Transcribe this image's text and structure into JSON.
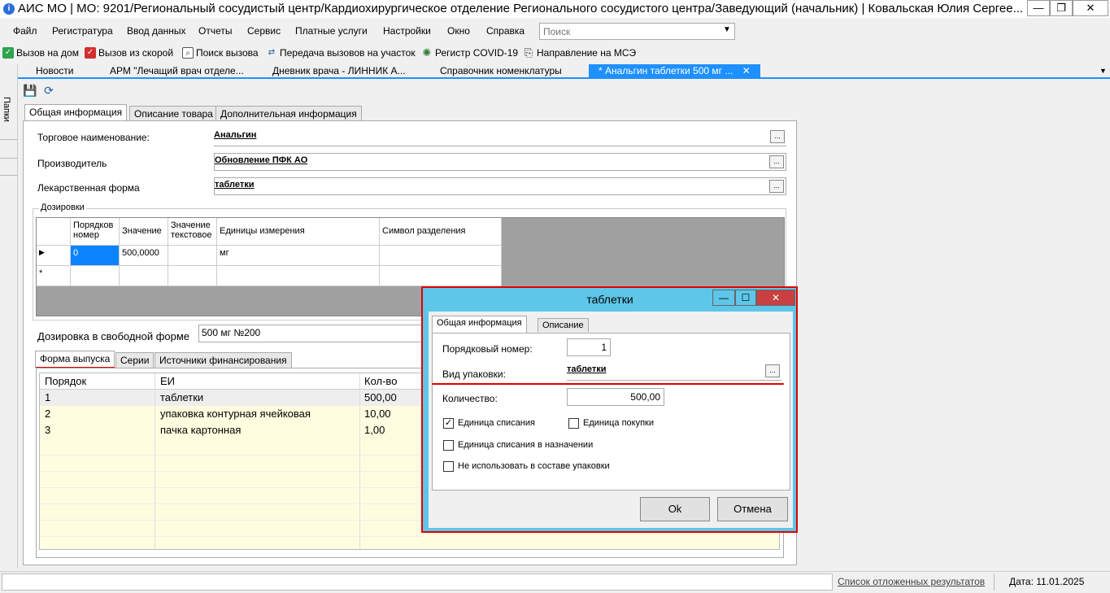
{
  "window": {
    "title": "АИС МО | МО: 9201/Региональный сосудистый центр/Кардиохирургическое отделение Регионального сосудистого центра/Заведующий (начальник) | Ковальская Юлия Сергее..."
  },
  "menu": {
    "items": [
      "Файл",
      "Регистратура",
      "Ввод данных",
      "Отчеты",
      "Сервис",
      "Платные услуги",
      "Настройки",
      "Окно",
      "Справка"
    ],
    "search_placeholder": "Поиск"
  },
  "toolbar": {
    "items": [
      "Вызов на дом",
      "Вызов из скорой",
      "Поиск вызова",
      "Передача вызовов на участок",
      "Регистр COVID-19",
      "Направление на МСЭ"
    ]
  },
  "doc_tabs": [
    "Новости",
    "АРМ \"Лечащий врач отделе...",
    "Дневник врача - ЛИННИК А...",
    "Справочник номенклатуры",
    "* Анальгин таблетки 500 мг ..."
  ],
  "sidebar": {
    "label": "Папки"
  },
  "main_tabs": [
    "Общая информация",
    "Описание товара",
    "Дополнительная информация"
  ],
  "form": {
    "trade_name_label": "Торговое наименование:",
    "trade_name_value": "Анальгин",
    "manufacturer_label": "Производитель",
    "manufacturer_value": "Обновление ПФК АО",
    "dosage_form_label": "Лекарственная форма",
    "dosage_form_value": "таблетки",
    "dosages_group": "Дозировки",
    "free_dosage_label": "Дозировка в свободной форме",
    "free_dosage_value": "500 мг №200"
  },
  "dosage_grid": {
    "columns": [
      "Порядков номер",
      "Значение",
      "Значение текстовое",
      "Единицы измерения",
      "Символ разделения"
    ],
    "rows": [
      [
        "0",
        "500,0000",
        "",
        "мг",
        ""
      ]
    ]
  },
  "sub_tabs": [
    "Форма выпуска",
    "Серии",
    "Источники финансирования"
  ],
  "release_list": {
    "columns": [
      "Порядок",
      "ЕИ",
      "Кол-во"
    ],
    "rows": [
      [
        "1",
        "таблетки",
        "500,00"
      ],
      [
        "2",
        "упаковка контурная ячейковая",
        "10,00"
      ],
      [
        "3",
        "пачка картонная",
        "1,00"
      ]
    ]
  },
  "dialog": {
    "title": "таблетки",
    "tabs": [
      "Общая информация",
      "Описание"
    ],
    "order_label": "Порядковый номер:",
    "order_value": "1",
    "pack_label": "Вид упаковки:",
    "pack_value": "таблетки",
    "qty_label": "Количество:",
    "qty_value": "500,00",
    "chk_writeoff": "Единица списания",
    "chk_purchase": "Единица покупки",
    "chk_writeoff_assign": "Единица списания в назначении",
    "chk_not_use": "Не использовать в составе упаковки",
    "ok": "Ok",
    "cancel": "Отмена"
  },
  "status": {
    "deferred": "Список отложенных результатов",
    "date": "Дата: 11.01.2025"
  }
}
